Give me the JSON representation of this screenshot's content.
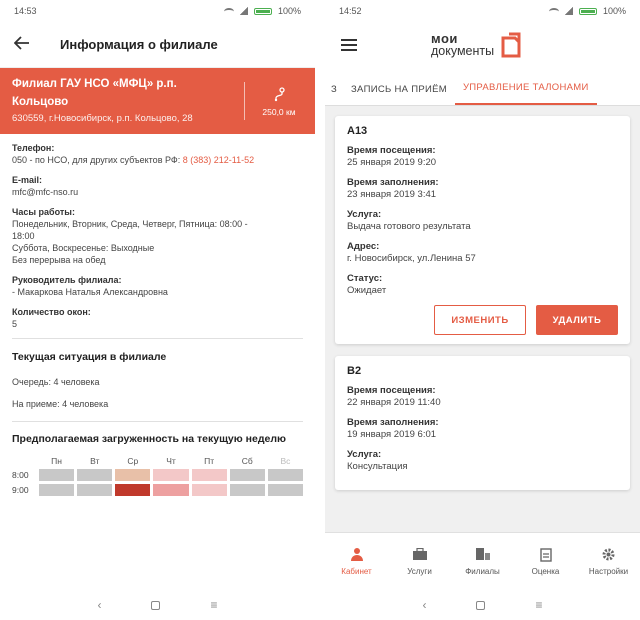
{
  "left": {
    "status": {
      "time": "14:53",
      "battery": "100%"
    },
    "header": {
      "title": "Информация о филиале"
    },
    "branch": {
      "name": "Филиал ГАУ НСО «МФЦ» р.п. Кольцово",
      "address": "630559, г.Новосибирск, р.п. Кольцово, 28",
      "distance": "250,0 км"
    },
    "fields": [
      {
        "label": "Телефон:",
        "value": "050 - по НСО, для других субъектов РФ: ",
        "link": "8 (383) 212-11-52"
      },
      {
        "label": "E-mail:",
        "value": "mfc@mfc-nso.ru"
      },
      {
        "label": "Часы работы:",
        "lines": [
          "Понедельник, Вторник, Среда, Четверг, Пятница: 08:00 -",
          "18:00",
          "Суббота, Воскресенье: Выходные",
          "Без перерыва на обед"
        ]
      },
      {
        "label": "Руководитель филиала:",
        "value": "- Макаркова Наталья Александровна"
      },
      {
        "label": "Количество окон:",
        "value": "5"
      }
    ],
    "situation": {
      "title": "Текущая ситуация в филиале",
      "queue": "Очередь: 4 человека",
      "reception": "На приеме: 4 человека"
    },
    "load": {
      "title": "Предполагаемая загруженность на текущую неделю",
      "days": [
        "Пн",
        "Вт",
        "Ср",
        "Чт",
        "Пт",
        "Сб",
        "Вс"
      ],
      "times": [
        "8:00",
        "9:00"
      ],
      "rows": [
        [
          "#c8c8c8",
          "#c8c8c8",
          "#e8c0a8",
          "#f3c8c8",
          "#f3c8c8",
          "#c8c8c8",
          "#c8c8c8"
        ],
        [
          "#c8c8c8",
          "#c8c8c8",
          "#c0392b",
          "#eda0a0",
          "#f3c8c8",
          "#c8c8c8",
          "#c8c8c8"
        ]
      ]
    }
  },
  "right": {
    "status": {
      "time": "14:52",
      "battery": "100%"
    },
    "logo": {
      "line1": "мои",
      "line2": "документы"
    },
    "tabs": [
      "ЗАПИСЬ НА ПРИЁМ",
      "УПРАВЛЕНИЕ ТАЛОНАМИ"
    ],
    "tab_cut": "З",
    "cards": [
      {
        "ticket": "А13",
        "visit_label": "Время посещения:",
        "visit": "25 января 2019 9:20",
        "filled_label": "Время заполнения:",
        "filled": "23 января 2019 3:41",
        "service_label": "Услуга:",
        "service": "Выдача готового результата",
        "address_label": "Адрес:",
        "address": "г. Новосибирск, ул.Ленина 57",
        "status_label": "Статус:",
        "status": "Ожидает",
        "edit": "ИЗМЕНИТЬ",
        "delete": "УДАЛИТЬ"
      },
      {
        "ticket": "В2",
        "visit_label": "Время посещения:",
        "visit": "22 января 2019 11:40",
        "filled_label": "Время заполнения:",
        "filled": "19 января 2019 6:01",
        "service_label": "Услуга:",
        "service": "Консультация"
      }
    ],
    "bottom_nav": [
      "Кабинет",
      "Услуги",
      "Филиалы",
      "Оценка",
      "Настройки"
    ]
  },
  "colors": {
    "accent": "#e45c44"
  }
}
